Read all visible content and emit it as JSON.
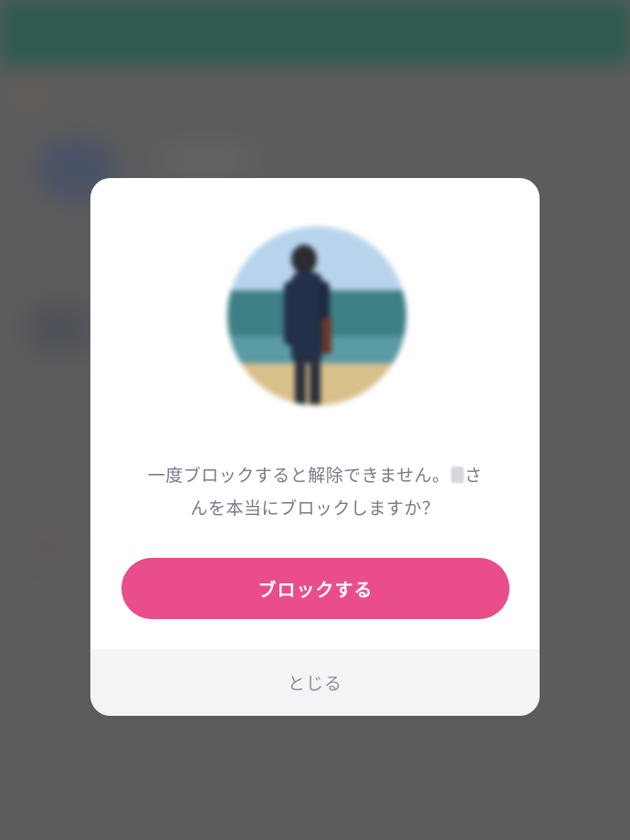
{
  "dialog": {
    "message_line1_before": "一度ブロックすると解除できません。",
    "message_line1_after": "さ",
    "message_line2": "んを本当にブロックしますか？",
    "block_button_label": "ブロックする",
    "close_label": "とじる"
  },
  "colors": {
    "accent": "#e94d8a",
    "overlay": "#5c5c5c",
    "message_text": "#777b86",
    "close_bg": "#f4f4f6"
  },
  "icons": {
    "avatar": "user-avatar"
  }
}
